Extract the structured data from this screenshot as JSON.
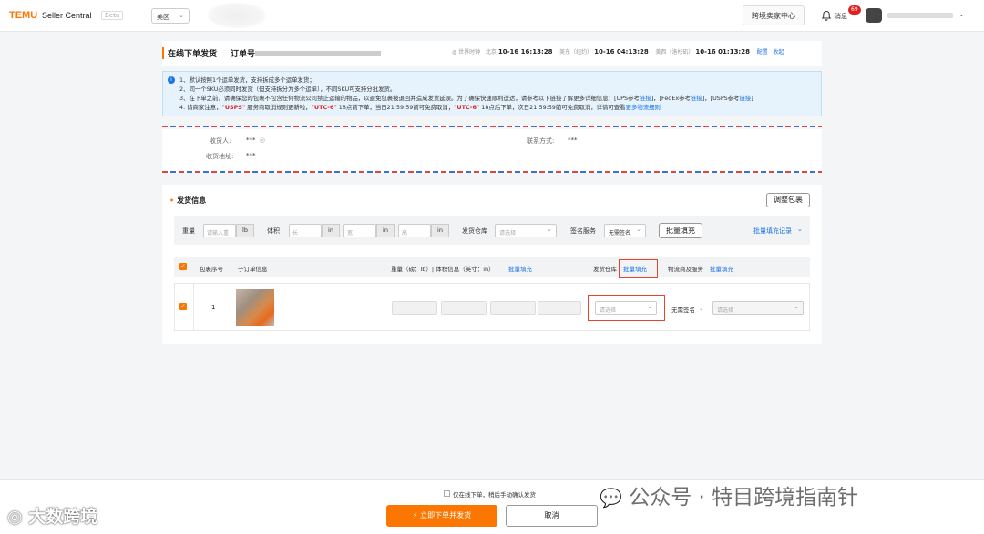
{
  "topbar": {
    "logo": "TEMU",
    "logo_sub": "Seller Central",
    "beta": "Beta",
    "region": "美区",
    "cross_border_center": "跨境卖家中心",
    "notifications_label": "消息",
    "notifications_count": "69"
  },
  "header": {
    "title": "在线下单发货",
    "order_label": "订单号:",
    "clocks": {
      "world_time": "世界时钟",
      "beijing_label": "北京",
      "beijing_time": "10-16 16:13:28",
      "us_east_label": "美东（纽约）",
      "us_east_time": "10-16 04:13:28",
      "us_west_label": "美西（洛杉矶）",
      "us_west_time": "10-16 01:13:28",
      "config": "配置",
      "collapse": "收起"
    }
  },
  "notice": {
    "line1": "1、默认按照1个运单发货，支持拆成多个运单发货；",
    "line2": "2、同一个SKU必须同时发货（但支持拆分为多个运单），不同SKU可支持分批发货。",
    "line3_a": "3、在下单之前，请确保您的包裹不包含任何物流公司禁止运输的物品，以避免包裹被退回并造成发货延误。为了确保快速顺利送达，请参考以下链接了解更多详细信息：[UPS参考",
    "line3_link1": "链接",
    "line3_b": "]，[FedEx参考",
    "line3_link2": "链接",
    "line3_c": "]，[USPS参考",
    "line3_link3": "链接",
    "line3_d": "]",
    "line4_a": "4. 请商家注意，",
    "line4_usps": "\"USPS\"",
    "line4_b": "服务商取消规则更新啦，",
    "line4_utc1": "\"UTC-6\"",
    "line4_c": "18点前下单，当日21:59:59前可免费取消；",
    "line4_utc2": "\"UTC-6\"",
    "line4_d": "18点后下单，次日21:59:59前可免费取消，详情可查看",
    "line4_link": "更多物流细则"
  },
  "receiver": {
    "name_label": "收货人:",
    "name_value": "***",
    "address_label": "收货地址:",
    "address_value": "***",
    "contact_label": "联系方式:",
    "contact_value": "***"
  },
  "shipping": {
    "title": "发货信息",
    "adjust_button": "调整包裹",
    "filter": {
      "weight_label": "重量",
      "weight_placeholder": "请输入重",
      "weight_unit": "lb",
      "volume_label": "体积",
      "length_placeholder": "长",
      "width_placeholder": "宽",
      "height_placeholder": "高",
      "dim_unit": "in",
      "warehouse_label": "发货仓库",
      "warehouse_placeholder": "请选择",
      "sign_label": "签名服务",
      "sign_value": "无需签名",
      "bulk_fill_button": "批量填充",
      "bulk_fill_record": "批量填充记录"
    },
    "table": {
      "col_package": "包裹序号",
      "col_suborder": "子订单信息",
      "col_weight": "重量（磅：lb）| 体积信息（英寸：in）",
      "col_weight_bulk": "批量填充",
      "col_warehouse": "发货仓库",
      "col_warehouse_bulk": "批量填充",
      "col_logistics": "物流商及服务",
      "col_logistics_bulk": "批量填充"
    },
    "row": {
      "index": "1",
      "warehouse_placeholder": "请选择",
      "sign_value": "无需签名",
      "logistics_placeholder": "请选择"
    }
  },
  "footer": {
    "checkbox_label": "仅在线下单，稍后手动确认发货",
    "submit_button": "立即下单并发货",
    "cancel_button": "取消"
  },
  "watermarks": {
    "left": "大数跨境",
    "right": "公众号 · 特目跨境指南针"
  },
  "colors": {
    "brand": "#fb7701",
    "link": "#1a73e8",
    "highlight": "#e0462d"
  }
}
